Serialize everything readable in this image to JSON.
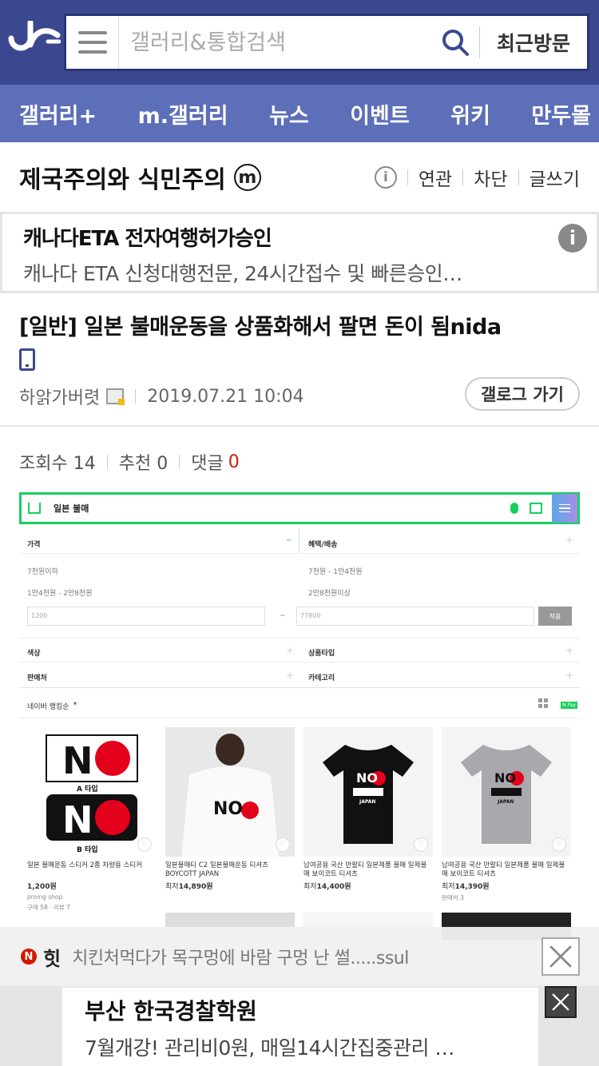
{
  "header": {
    "search_placeholder": "갤러리&통합검색",
    "recent_label": "최근방문"
  },
  "nav": {
    "items": [
      "갤러리+",
      "m.갤러리",
      "뉴스",
      "이벤트",
      "위키",
      "만두몰"
    ]
  },
  "gallery": {
    "title": "제국주의와 식민주의",
    "badge": "m",
    "info_icon": "i",
    "actions": [
      "연관",
      "차단",
      "글쓰기"
    ]
  },
  "ad_top": {
    "title": "캐나다ETA 전자여행허가승인",
    "desc": "캐나다 ETA 신청대행전문, 24시간접수 및 빠른승인…",
    "info_icon": "i"
  },
  "post": {
    "title": "[일반] 일본 불매운동을 상품화해서 팔면 돈이 됨nida",
    "author": "하앍가버렷",
    "date": "2019.07.21 10:04",
    "gallog_button": "갤로그 가기",
    "views_label": "조회수 14",
    "recommend_label": "추천 0",
    "comments_label": "댓글",
    "comments_count": "0"
  },
  "embedded": {
    "query": "일본 불매",
    "filters": {
      "price_label": "가격",
      "benefit_label": "혜택/배송",
      "price_options": [
        "7천원이하",
        "7천원 - 1만4천원",
        "1만4천원 - 2만8천원",
        "2만8천원이상"
      ],
      "min_price": "1200",
      "max_price": "77800",
      "range_sep": "~",
      "apply": "적용",
      "color_label": "색상",
      "type_label": "상품타입",
      "seller_label": "판매처",
      "category_label": "카테고리",
      "sort_label": "네이버 랭킹순",
      "npay": "N Pay"
    },
    "products": [
      {
        "name": "일본 불매운동 스티커 2종 차량용 스티커",
        "price": "1,200원",
        "price_prefix": "",
        "sub1": "proing shop",
        "sub2": "구매 58 · 리뷰 7",
        "label_a": "A 타입",
        "label_b": "B 타입"
      },
      {
        "name": "일본불매티 C2 일본불매운동 티셔츠 BOYCOTT JAPAN",
        "price": "14,890원",
        "price_prefix": "최저",
        "sub1": "",
        "sub2": ""
      },
      {
        "name": "남여공용 국산 반팔티 일본제품 불매 일제불매 보이코트 티셔츠",
        "price": "14,400원",
        "price_prefix": "최저",
        "sub1": "",
        "sub2": ""
      },
      {
        "name": "남여공용 국산 반팔티 일본제품 불매 일제불매 보이코트 티셔츠",
        "price": "14,390원",
        "price_prefix": "최저",
        "sub1": "판매처 3",
        "sub2": ""
      }
    ],
    "print_no": "NO",
    "print_japan": "JAPAN"
  },
  "hot": {
    "badge": "N",
    "label": "힛",
    "text": "치킨처먹다가 목구멍에 바람 구멍 난 썰.....ssul"
  },
  "ad_bottom": {
    "title": "부산 한국경찰학원",
    "desc": "7월개강! 관리비0원, 매일14시간집중관리 …"
  },
  "colors": {
    "header_bg": "#3b4890",
    "nav_bg": "#5d6fb9",
    "accent_red": "#d31900",
    "naver_green": "#19ce60"
  }
}
